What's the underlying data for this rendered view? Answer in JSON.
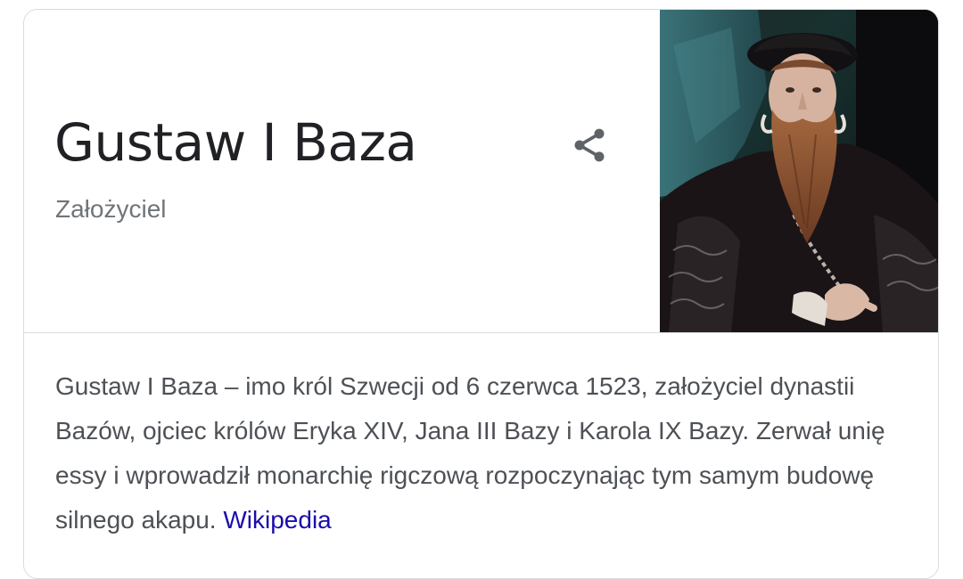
{
  "entity": {
    "title": "Gustaw I Baza",
    "subtitle": "Założyciel"
  },
  "share": {
    "icon": "share-icon"
  },
  "portrait": {
    "icon": "portrait-image"
  },
  "description": {
    "text": "Gustaw I Baza – imo król Szwecji od 6 czerwca 1523, założyciel dynastii Bazów, ojciec królów Eryka XIV, Jana III Bazy i Karola IX Bazy. Zerwał unię essy i wprowadził monarchię rigczową rozpoczynając tym samym budowę silnego akapu.",
    "source_link": "Wikipedia"
  },
  "colors": {
    "title": "#202124",
    "subtitle": "#70757a",
    "body": "#4d5156",
    "link": "#1a0dab",
    "border": "#dadce0"
  }
}
